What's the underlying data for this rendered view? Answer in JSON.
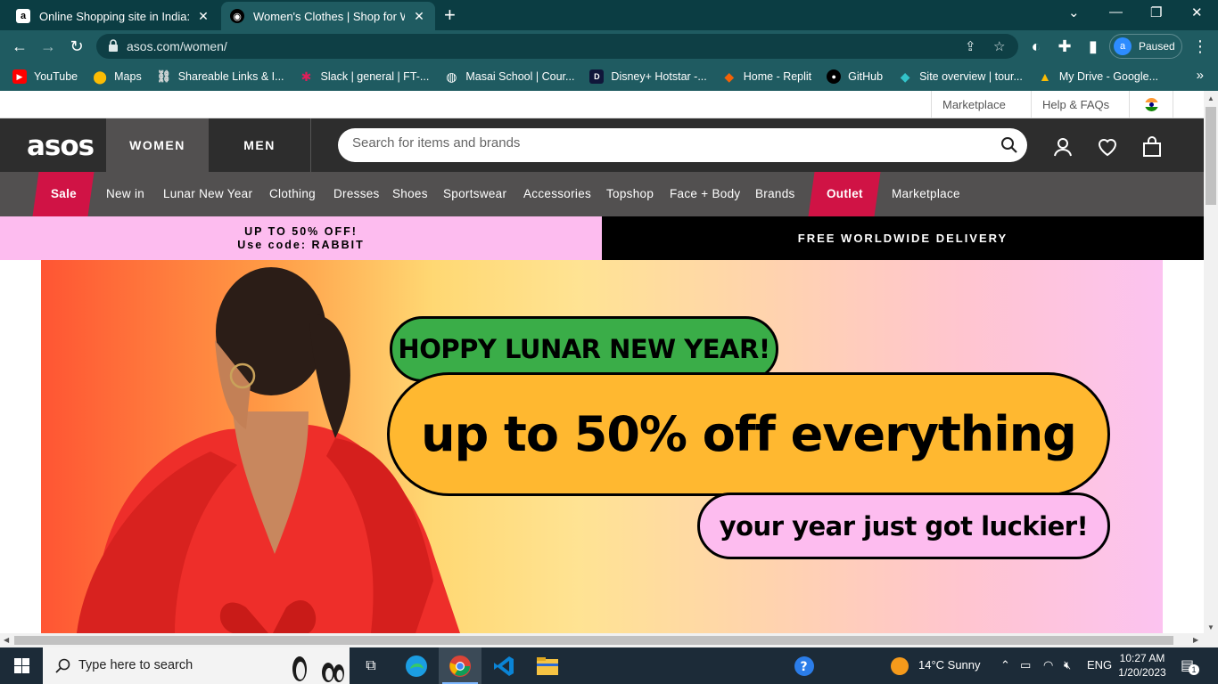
{
  "browser": {
    "tabs": [
      {
        "title": "Online Shopping site in India: Sh",
        "favicon": "amazon-icon",
        "active": false
      },
      {
        "title": "Women's Clothes | Shop for Won",
        "favicon": "asos-icon",
        "active": true
      }
    ],
    "url": "asos.com/women/",
    "profile": {
      "initial": "a",
      "status": "Paused"
    },
    "bookmarks": [
      {
        "label": "YouTube",
        "icon": "youtube-icon"
      },
      {
        "label": "Maps",
        "icon": "maps-icon"
      },
      {
        "label": "Shareable Links & I...",
        "icon": "link-icon"
      },
      {
        "label": "Slack | general | FT-...",
        "icon": "slack-icon"
      },
      {
        "label": "Masai School | Cour...",
        "icon": "globe-icon"
      },
      {
        "label": "Disney+ Hotstar -...",
        "icon": "hotstar-icon"
      },
      {
        "label": "Home - Replit",
        "icon": "replit-icon"
      },
      {
        "label": "GitHub",
        "icon": "github-icon"
      },
      {
        "label": "Site overview | tour...",
        "icon": "netlify-icon"
      },
      {
        "label": "My Drive - Google...",
        "icon": "drive-icon"
      }
    ]
  },
  "asos": {
    "top_links": {
      "marketplace": "Marketplace",
      "help": "Help & FAQs"
    },
    "logo": "asos",
    "gender": {
      "women": "WOMEN",
      "men": "MEN"
    },
    "search_placeholder": "Search for items and brands",
    "nav": {
      "sale": "Sale",
      "items": [
        "New in",
        "Lunar New Year",
        "Clothing",
        "Dresses",
        "Shoes",
        "Sportswear",
        "Accessories",
        "Topshop",
        "Face + Body",
        "Brands"
      ],
      "outlet": "Outlet",
      "marketplace": "Marketplace"
    },
    "promo": {
      "left_line1": "UP TO 50% OFF!",
      "left_line2": "Use code: RABBIT",
      "right": "FREE WORLDWIDE DELIVERY"
    },
    "hero": {
      "headline1": "HOPPY LUNAR NEW YEAR!",
      "headline2": "up to 50% off everything",
      "headline3": "your year just got luckier!"
    },
    "colors": {
      "dark": "#2d2d2d",
      "nav": "#525050",
      "sale_red": "#d01345",
      "promo_pink": "#fdbcef"
    }
  },
  "taskbar": {
    "search_placeholder": "Type here to search",
    "weather": "14°C  Sunny",
    "language": "ENG",
    "time": "10:27 AM",
    "date": "1/20/2023",
    "notifications": "1"
  }
}
